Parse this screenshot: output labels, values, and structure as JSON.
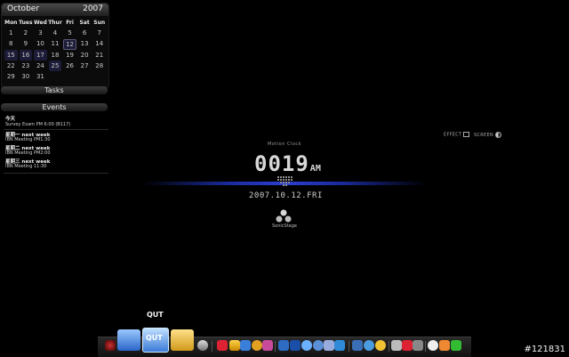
{
  "calendar": {
    "month": "October",
    "year": "2007",
    "day_headers": [
      "Mon",
      "Tues",
      "Wed",
      "Thur",
      "Fri",
      "Sat",
      "Sun"
    ],
    "weeks": [
      [
        "1",
        "2",
        "3",
        "4",
        "5",
        "6",
        "7"
      ],
      [
        "8",
        "9",
        "10",
        "11",
        "12",
        "13",
        "14"
      ],
      [
        "15",
        "16",
        "17",
        "18",
        "19",
        "20",
        "21"
      ],
      [
        "22",
        "23",
        "24",
        "25",
        "26",
        "27",
        "28"
      ],
      [
        "29",
        "30",
        "31",
        "",
        "",
        "",
        ""
      ]
    ],
    "highlighted": [
      "12",
      "15",
      "16",
      "17",
      "25"
    ],
    "today": "12"
  },
  "tasks_label": "Tasks",
  "events_label": "Events",
  "events": [
    {
      "text": "今天",
      "bold": true
    },
    {
      "text": "Survey Exam PM 6:00 (B117)",
      "bold": false
    },
    {
      "text": "星期一 next week",
      "bold": true
    },
    {
      "text": "IBN Meeting PM1:30",
      "bold": false
    },
    {
      "text": "星期二 next week",
      "bold": true
    },
    {
      "text": "IBN Meeting PM2:00",
      "bold": false
    },
    {
      "text": "星期三 next week",
      "bold": true
    },
    {
      "text": "IBN Meeting 11:30",
      "bold": false
    }
  ],
  "toggles": {
    "effect": "EFFECT",
    "screen": "SCREEN"
  },
  "clock": {
    "title": "Motion Clock",
    "time": "0019",
    "ampm": "AM",
    "date": "2007.10.12.FRI"
  },
  "sonicstage": "SonicStage",
  "dock": {
    "hover_label": "QUT",
    "items": [
      "system-icon",
      "folder-icon",
      "qut-folder-icon",
      "open-folder-icon",
      "tools-icon",
      "media-icon",
      "pc-icon",
      "mail-icon",
      "browser-icon",
      "music-icon",
      "chat-icon",
      "globe-icon",
      "messenger-icon",
      "camera-icon",
      "settings-icon",
      "clock-icon",
      "notes-icon"
    ],
    "colors": {
      "accent": "#2b3fd0",
      "dock_bg": "#1a1a1a"
    }
  },
  "watermark": "#121831"
}
